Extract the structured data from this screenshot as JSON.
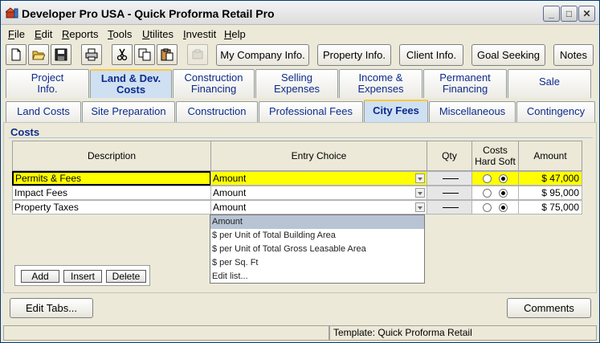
{
  "window": {
    "title": "Developer Pro  USA - Quick Proforma Retail Pro",
    "minimize_glyph": "_",
    "maximize_glyph": "□",
    "close_glyph": "✕"
  },
  "menu": [
    {
      "label_u": "F",
      "label_rest": "ile"
    },
    {
      "label_u": "E",
      "label_rest": "dit"
    },
    {
      "label_u": "R",
      "label_rest": "eports"
    },
    {
      "label_u": "T",
      "label_rest": "ools"
    },
    {
      "label_u": "U",
      "label_rest": "tilites"
    },
    {
      "label_u": "I",
      "label_rest": "nvestit"
    },
    {
      "label_u": "H",
      "label_rest": "elp"
    }
  ],
  "toolbar": {
    "icons": [
      "new-file-icon",
      "open-folder-icon",
      "save-icon",
      "print-icon",
      "cut-icon",
      "copy-icon",
      "paste-icon",
      "disabled-tool-icon"
    ],
    "my_company_info": "My Company Info.",
    "property_info": "Property Info.",
    "client_info": "Client Info.",
    "goal_seeking": "Goal Seeking",
    "notes": "Notes"
  },
  "main_tabs": [
    {
      "line1": "Project",
      "line2": "Info."
    },
    {
      "line1": "Land & Dev.",
      "line2": "Costs"
    },
    {
      "line1": "Construction",
      "line2": "Financing"
    },
    {
      "line1": "Selling",
      "line2": "Expenses"
    },
    {
      "line1": "Income &",
      "line2": "Expenses"
    },
    {
      "line1": "Permanent",
      "line2": "Financing"
    },
    {
      "line1": "Sale",
      "line2": ""
    }
  ],
  "sub_tabs": [
    "Land Costs",
    "Site Preparation",
    "Construction",
    "Professional Fees",
    "City Fees",
    "Miscellaneous",
    "Contingency"
  ],
  "section": {
    "title": "Costs"
  },
  "grid": {
    "headers": {
      "description": "Description",
      "entry_choice": "Entry Choice",
      "qty": "Qty",
      "costs_line1": "Costs",
      "costs_line2": "Hard Soft",
      "amount": "Amount"
    },
    "rows": [
      {
        "description": "Permits & Fees",
        "entry_choice": "Amount",
        "hard": false,
        "soft": true,
        "amount": "$ 47,000"
      },
      {
        "description": "Impact Fees",
        "entry_choice": "Amount",
        "hard": false,
        "soft": true,
        "amount": "$ 95,000"
      },
      {
        "description": "Property Taxes",
        "entry_choice": "Amount",
        "hard": false,
        "soft": true,
        "amount": "$ 75,000"
      }
    ]
  },
  "dropdown_options": [
    "Amount",
    "$ per Unit of Total Building Area",
    "$ per Unit of Total Gross Leasable Area",
    "$ per Sq. Ft",
    "Edit list..."
  ],
  "row_buttons": {
    "add": "Add",
    "insert": "Insert",
    "delete": "Delete"
  },
  "bottom": {
    "edit_tabs": "Edit Tabs...",
    "comments": "Comments"
  },
  "status": {
    "left": "",
    "right": "Template: Quick Proforma Retail"
  }
}
